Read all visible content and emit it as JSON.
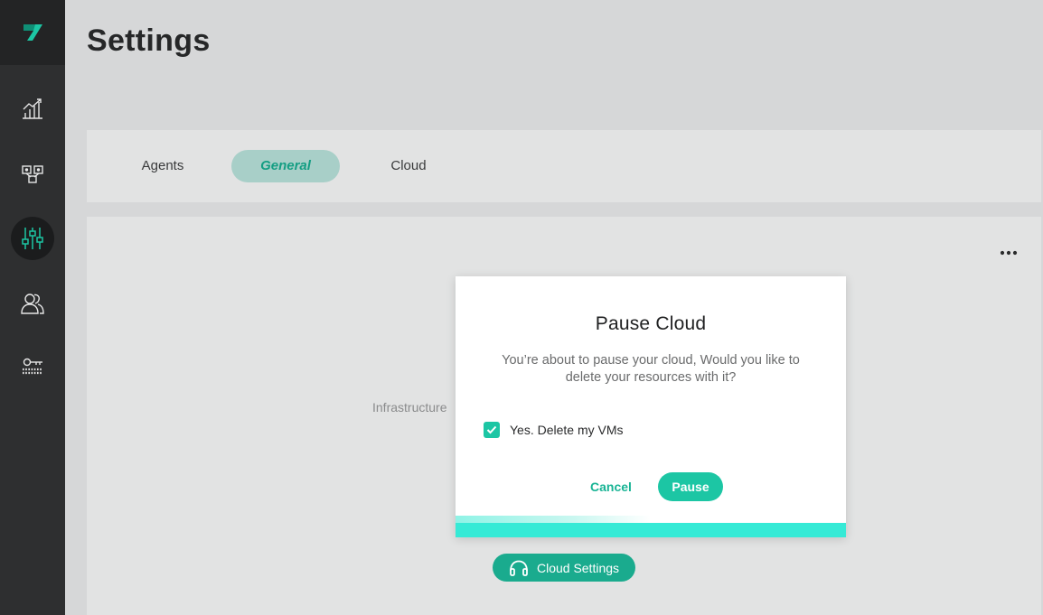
{
  "app": {
    "logo_icon": "brand-logo-icon",
    "brand_color": "#1cc6a4"
  },
  "sidebar": {
    "items": [
      {
        "id": "analytics",
        "icon": "chart-icon",
        "active": false
      },
      {
        "id": "topology",
        "icon": "network-icon",
        "active": false
      },
      {
        "id": "settings",
        "icon": "sliders-icon",
        "active": true
      },
      {
        "id": "users",
        "icon": "users-icon",
        "active": false
      },
      {
        "id": "keys",
        "icon": "key-icon",
        "active": false
      }
    ]
  },
  "header": {
    "title": "Settings"
  },
  "tabs": [
    {
      "label": "Agents",
      "active": false
    },
    {
      "label": "General",
      "active": true
    },
    {
      "label": "Cloud",
      "active": false
    }
  ],
  "content": {
    "more_icon": "more-horizontal-icon",
    "background_text": "Infrastructure",
    "cloud_settings_label": "Cloud Settings",
    "cloud_settings_icon": "headphones-icon"
  },
  "modal": {
    "title": "Pause Cloud",
    "message": "You’re about to pause your cloud, Would you like to delete your resources with it?",
    "checkbox_label": "Yes. Delete my VMs",
    "checkbox_checked": true,
    "cancel_label": "Cancel",
    "pause_label": "Pause",
    "progress_fraction": 0.5
  }
}
